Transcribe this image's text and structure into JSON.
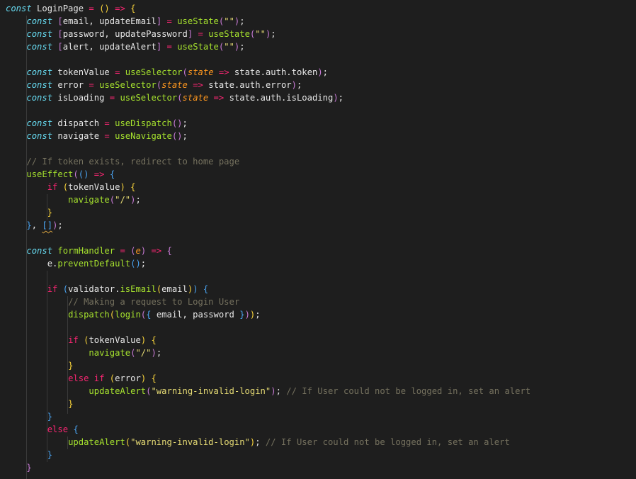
{
  "editor": {
    "lines": [
      [
        [
          "kw",
          "const"
        ],
        [
          "txt",
          " LoginPage "
        ],
        [
          "op",
          "="
        ],
        [
          "txt",
          " "
        ],
        [
          "br1",
          "()"
        ],
        [
          "txt",
          " "
        ],
        [
          "op",
          "=>"
        ],
        [
          "txt",
          " "
        ],
        [
          "br1",
          "{"
        ]
      ],
      [
        [
          "txt",
          "    "
        ],
        [
          "kw",
          "const"
        ],
        [
          "txt",
          " "
        ],
        [
          "br2",
          "["
        ],
        [
          "txt",
          "email, updateEmail"
        ],
        [
          "br2",
          "]"
        ],
        [
          "txt",
          " "
        ],
        [
          "op",
          "="
        ],
        [
          "txt",
          " "
        ],
        [
          "fn",
          "useState"
        ],
        [
          "br2",
          "("
        ],
        [
          "str",
          "\"\""
        ],
        [
          "br2",
          ")"
        ],
        [
          "txt",
          ";"
        ]
      ],
      [
        [
          "txt",
          "    "
        ],
        [
          "kw",
          "const"
        ],
        [
          "txt",
          " "
        ],
        [
          "br2",
          "["
        ],
        [
          "txt",
          "password, updatePassword"
        ],
        [
          "br2",
          "]"
        ],
        [
          "txt",
          " "
        ],
        [
          "op",
          "="
        ],
        [
          "txt",
          " "
        ],
        [
          "fn",
          "useState"
        ],
        [
          "br2",
          "("
        ],
        [
          "str",
          "\"\""
        ],
        [
          "br2",
          ")"
        ],
        [
          "txt",
          ";"
        ]
      ],
      [
        [
          "txt",
          "    "
        ],
        [
          "kw",
          "const"
        ],
        [
          "txt",
          " "
        ],
        [
          "br2",
          "["
        ],
        [
          "txt",
          "alert, updateAlert"
        ],
        [
          "br2",
          "]"
        ],
        [
          "txt",
          " "
        ],
        [
          "op",
          "="
        ],
        [
          "txt",
          " "
        ],
        [
          "fn",
          "useState"
        ],
        [
          "br2",
          "("
        ],
        [
          "str",
          "\"\""
        ],
        [
          "br2",
          ")"
        ],
        [
          "txt",
          ";"
        ]
      ],
      [],
      [
        [
          "txt",
          "    "
        ],
        [
          "kw",
          "const"
        ],
        [
          "txt",
          " tokenValue "
        ],
        [
          "op",
          "="
        ],
        [
          "txt",
          " "
        ],
        [
          "fn",
          "useSelector"
        ],
        [
          "br2",
          "("
        ],
        [
          "param",
          "state"
        ],
        [
          "txt",
          " "
        ],
        [
          "op",
          "=>"
        ],
        [
          "txt",
          " state.auth.token"
        ],
        [
          "br2",
          ")"
        ],
        [
          "txt",
          ";"
        ]
      ],
      [
        [
          "txt",
          "    "
        ],
        [
          "kw",
          "const"
        ],
        [
          "txt",
          " error "
        ],
        [
          "op",
          "="
        ],
        [
          "txt",
          " "
        ],
        [
          "fn",
          "useSelector"
        ],
        [
          "br2",
          "("
        ],
        [
          "param",
          "state"
        ],
        [
          "txt",
          " "
        ],
        [
          "op",
          "=>"
        ],
        [
          "txt",
          " state.auth.error"
        ],
        [
          "br2",
          ")"
        ],
        [
          "txt",
          ";"
        ]
      ],
      [
        [
          "txt",
          "    "
        ],
        [
          "kw",
          "const"
        ],
        [
          "txt",
          " isLoading "
        ],
        [
          "op",
          "="
        ],
        [
          "txt",
          " "
        ],
        [
          "fn",
          "useSelector"
        ],
        [
          "br2",
          "("
        ],
        [
          "param",
          "state"
        ],
        [
          "txt",
          " "
        ],
        [
          "op",
          "=>"
        ],
        [
          "txt",
          " state.auth.isLoading"
        ],
        [
          "br2",
          ")"
        ],
        [
          "txt",
          ";"
        ]
      ],
      [],
      [
        [
          "txt",
          "    "
        ],
        [
          "kw",
          "const"
        ],
        [
          "txt",
          " dispatch "
        ],
        [
          "op",
          "="
        ],
        [
          "txt",
          " "
        ],
        [
          "fn",
          "useDispatch"
        ],
        [
          "br2",
          "()"
        ],
        [
          "txt",
          ";"
        ]
      ],
      [
        [
          "txt",
          "    "
        ],
        [
          "kw",
          "const"
        ],
        [
          "txt",
          " navigate "
        ],
        [
          "op",
          "="
        ],
        [
          "txt",
          " "
        ],
        [
          "fn",
          "useNavigate"
        ],
        [
          "br2",
          "()"
        ],
        [
          "txt",
          ";"
        ]
      ],
      [],
      [
        [
          "txt",
          "    "
        ],
        [
          "cmt",
          "// If token exists, redirect to home page"
        ]
      ],
      [
        [
          "txt",
          "    "
        ],
        [
          "fn",
          "useEffect"
        ],
        [
          "br2",
          "("
        ],
        [
          "br3",
          "()"
        ],
        [
          "txt",
          " "
        ],
        [
          "op",
          "=>"
        ],
        [
          "txt",
          " "
        ],
        [
          "br3",
          "{"
        ]
      ],
      [
        [
          "txt",
          "        "
        ],
        [
          "ctl",
          "if"
        ],
        [
          "txt",
          " "
        ],
        [
          "br1",
          "("
        ],
        [
          "txt",
          "tokenValue"
        ],
        [
          "br1",
          ")"
        ],
        [
          "txt",
          " "
        ],
        [
          "br1",
          "{"
        ]
      ],
      [
        [
          "txt",
          "            "
        ],
        [
          "fn",
          "navigate"
        ],
        [
          "br2",
          "("
        ],
        [
          "str",
          "\"/\""
        ],
        [
          "br2",
          ")"
        ],
        [
          "txt",
          ";"
        ]
      ],
      [
        [
          "txt",
          "        "
        ],
        [
          "br1",
          "}"
        ]
      ],
      [
        [
          "txt",
          "    "
        ],
        [
          "br3",
          "}"
        ],
        [
          "txt",
          ", "
        ],
        [
          "br3",
          "[]"
        ],
        [
          "br2",
          ")"
        ],
        [
          "txt",
          ";"
        ]
      ],
      [],
      [
        [
          "txt",
          "    "
        ],
        [
          "kw",
          "const"
        ],
        [
          "txt",
          " "
        ],
        [
          "fn",
          "formHandler"
        ],
        [
          "txt",
          " "
        ],
        [
          "op",
          "="
        ],
        [
          "txt",
          " "
        ],
        [
          "br2",
          "("
        ],
        [
          "param",
          "e"
        ],
        [
          "br2",
          ")"
        ],
        [
          "txt",
          " "
        ],
        [
          "op",
          "=>"
        ],
        [
          "txt",
          " "
        ],
        [
          "br2",
          "{"
        ]
      ],
      [
        [
          "txt",
          "        e."
        ],
        [
          "fn",
          "preventDefault"
        ],
        [
          "br3",
          "()"
        ],
        [
          "txt",
          ";"
        ]
      ],
      [],
      [
        [
          "txt",
          "        "
        ],
        [
          "ctl",
          "if"
        ],
        [
          "txt",
          " "
        ],
        [
          "br3",
          "("
        ],
        [
          "txt",
          "validator."
        ],
        [
          "fn",
          "isEmail"
        ],
        [
          "br1",
          "("
        ],
        [
          "txt",
          "email"
        ],
        [
          "br1",
          ")"
        ],
        [
          "br3",
          ")"
        ],
        [
          "txt",
          " "
        ],
        [
          "br3",
          "{"
        ]
      ],
      [
        [
          "txt",
          "            "
        ],
        [
          "cmt",
          "// Making a request to Login User"
        ]
      ],
      [
        [
          "txt",
          "            "
        ],
        [
          "fn",
          "dispatch"
        ],
        [
          "br1",
          "("
        ],
        [
          "fn",
          "login"
        ],
        [
          "br2",
          "("
        ],
        [
          "br3",
          "{"
        ],
        [
          "txt",
          " email, password "
        ],
        [
          "br3",
          "}"
        ],
        [
          "br2",
          ")"
        ],
        [
          "br1",
          ")"
        ],
        [
          "txt",
          ";"
        ]
      ],
      [],
      [
        [
          "txt",
          "            "
        ],
        [
          "ctl",
          "if"
        ],
        [
          "txt",
          " "
        ],
        [
          "br1",
          "("
        ],
        [
          "txt",
          "tokenValue"
        ],
        [
          "br1",
          ")"
        ],
        [
          "txt",
          " "
        ],
        [
          "br1",
          "{"
        ]
      ],
      [
        [
          "txt",
          "                "
        ],
        [
          "fn",
          "navigate"
        ],
        [
          "br2",
          "("
        ],
        [
          "str",
          "\"/\""
        ],
        [
          "br2",
          ")"
        ],
        [
          "txt",
          ";"
        ]
      ],
      [
        [
          "txt",
          "            "
        ],
        [
          "br1",
          "}"
        ]
      ],
      [
        [
          "txt",
          "            "
        ],
        [
          "ctl",
          "else if"
        ],
        [
          "txt",
          " "
        ],
        [
          "br1",
          "("
        ],
        [
          "txt",
          "error"
        ],
        [
          "br1",
          ")"
        ],
        [
          "txt",
          " "
        ],
        [
          "br1",
          "{"
        ]
      ],
      [
        [
          "txt",
          "                "
        ],
        [
          "fn",
          "updateAlert"
        ],
        [
          "br2",
          "("
        ],
        [
          "str",
          "\"warning-invalid-login\""
        ],
        [
          "br2",
          ")"
        ],
        [
          "txt",
          "; "
        ],
        [
          "cmt",
          "// If User could not be logged in, set an alert"
        ]
      ],
      [
        [
          "txt",
          "            "
        ],
        [
          "br1",
          "}"
        ]
      ],
      [
        [
          "txt",
          "        "
        ],
        [
          "br3",
          "}"
        ]
      ],
      [
        [
          "txt",
          "        "
        ],
        [
          "ctl",
          "else"
        ],
        [
          "txt",
          " "
        ],
        [
          "br3",
          "{"
        ]
      ],
      [
        [
          "txt",
          "            "
        ],
        [
          "fn",
          "updateAlert"
        ],
        [
          "br1",
          "("
        ],
        [
          "str",
          "\"warning-invalid-login\""
        ],
        [
          "br1",
          ")"
        ],
        [
          "txt",
          "; "
        ],
        [
          "cmt",
          "// If User could not be logged in, set an alert"
        ]
      ],
      [
        [
          "txt",
          "        "
        ],
        [
          "br3",
          "}"
        ]
      ],
      [
        [
          "txt",
          "    "
        ],
        [
          "br2",
          "}"
        ]
      ]
    ]
  }
}
